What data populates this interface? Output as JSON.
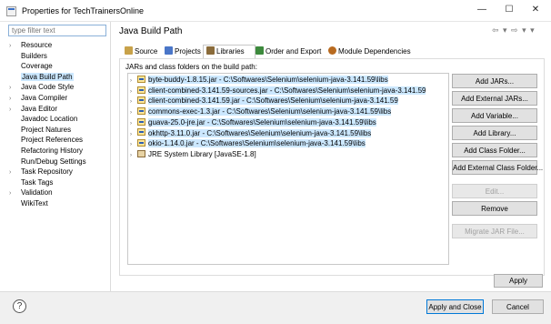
{
  "window": {
    "title": "Properties for TechTrainersOnline",
    "minimize": "—",
    "maximize": "☐",
    "close": "✕"
  },
  "sidebar": {
    "filter_placeholder": "type filter text",
    "items": [
      {
        "label": "Resource",
        "expandable": true,
        "selected": false
      },
      {
        "label": "Builders",
        "expandable": false,
        "selected": false
      },
      {
        "label": "Coverage",
        "expandable": false,
        "selected": false
      },
      {
        "label": "Java Build Path",
        "expandable": false,
        "selected": true
      },
      {
        "label": "Java Code Style",
        "expandable": true,
        "selected": false
      },
      {
        "label": "Java Compiler",
        "expandable": true,
        "selected": false
      },
      {
        "label": "Java Editor",
        "expandable": true,
        "selected": false
      },
      {
        "label": "Javadoc Location",
        "expandable": false,
        "selected": false
      },
      {
        "label": "Project Natures",
        "expandable": false,
        "selected": false
      },
      {
        "label": "Project References",
        "expandable": false,
        "selected": false
      },
      {
        "label": "Refactoring History",
        "expandable": false,
        "selected": false
      },
      {
        "label": "Run/Debug Settings",
        "expandable": false,
        "selected": false
      },
      {
        "label": "Task Repository",
        "expandable": true,
        "selected": false
      },
      {
        "label": "Task Tags",
        "expandable": false,
        "selected": false
      },
      {
        "label": "Validation",
        "expandable": true,
        "selected": false
      },
      {
        "label": "WikiText",
        "expandable": false,
        "selected": false
      }
    ]
  },
  "main": {
    "title": "Java Build Path",
    "nav_icons": "⇦ ▾ ⇨ ▾ ▾",
    "tabs": [
      {
        "label": "Source",
        "icon": "source-folder-icon",
        "active": false
      },
      {
        "label": "Projects",
        "icon": "projects-icon",
        "active": false
      },
      {
        "label": "Libraries",
        "icon": "libraries-icon",
        "active": true
      },
      {
        "label": "Order and Export",
        "icon": "order-export-icon",
        "active": false
      },
      {
        "label": "Module Dependencies",
        "icon": "module-icon",
        "active": false
      }
    ],
    "list_label": "JARs and class folders on the build path:",
    "entries": [
      {
        "text": "byte-buddy-1.8.15.jar - C:\\Softwares\\Selenium\\selenium-java-3.141.59\\libs",
        "type": "jar",
        "selected": true
      },
      {
        "text": "client-combined-3.141.59-sources.jar - C:\\Softwares\\Selenium\\selenium-java-3.141.59",
        "type": "jar",
        "selected": true
      },
      {
        "text": "client-combined-3.141.59.jar - C:\\Softwares\\Selenium\\selenium-java-3.141.59",
        "type": "jar",
        "selected": true
      },
      {
        "text": "commons-exec-1.3.jar - C:\\Softwares\\Selenium\\selenium-java-3.141.59\\libs",
        "type": "jar",
        "selected": true
      },
      {
        "text": "guava-25.0-jre.jar - C:\\Softwares\\Selenium\\selenium-java-3.141.59\\libs",
        "type": "jar",
        "selected": true
      },
      {
        "text": "okhttp-3.11.0.jar - C:\\Softwares\\Selenium\\selenium-java-3.141.59\\libs",
        "type": "jar",
        "selected": true
      },
      {
        "text": "okio-1.14.0.jar - C:\\Softwares\\Selenium\\selenium-java-3.141.59\\libs",
        "type": "jar",
        "selected": true
      },
      {
        "text": "JRE System Library [JavaSE-1.8]",
        "type": "library",
        "selected": false
      }
    ],
    "buttons": [
      {
        "label": "Add JARs...",
        "enabled": true
      },
      {
        "label": "Add External JARs...",
        "enabled": true
      },
      {
        "label": "Add Variable...",
        "enabled": true
      },
      {
        "label": "Add Library...",
        "enabled": true
      },
      {
        "label": "Add Class Folder...",
        "enabled": true
      },
      {
        "label": "Add External Class Folder...",
        "enabled": true
      },
      {
        "label": "Edit...",
        "enabled": false
      },
      {
        "label": "Remove",
        "enabled": true
      },
      {
        "label": "Migrate JAR File...",
        "enabled": false
      }
    ],
    "apply_label": "Apply"
  },
  "footer": {
    "help_icon": "?",
    "apply_close_label": "Apply and Close",
    "cancel_label": "Cancel"
  }
}
